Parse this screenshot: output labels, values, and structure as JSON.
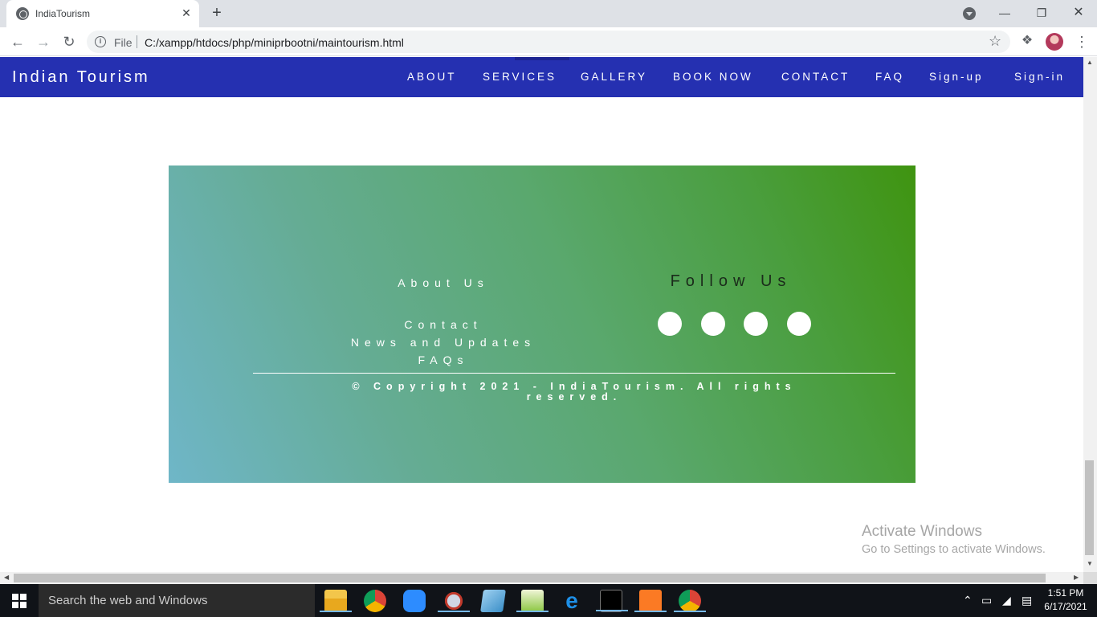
{
  "browser": {
    "tab_title": "IndiaTourism",
    "tab_close": "✕",
    "new_tab": "+",
    "scheme_label": "File",
    "url": "C:/xampp/htdocs/php/miniprbootni/maintourism.html"
  },
  "site": {
    "brand": "Indian Tourism",
    "nav": [
      "ABOUT",
      "SERVICES",
      "GALLERY",
      "BOOK NOW",
      "CONTACT",
      "FAQ",
      "Sign-up",
      "Sign-in"
    ]
  },
  "footer": {
    "about": "About Us",
    "links": [
      "Contact",
      "News and Updates",
      "FAQs"
    ],
    "follow_title": "Follow Us",
    "copyright": "© Copyright 2021 - IndiaTourism. All rights reserved."
  },
  "windows_watermark": {
    "title": "Activate Windows",
    "subtitle": "Go to Settings to activate Windows."
  },
  "taskbar": {
    "search_placeholder": "Search the web and Windows",
    "time": "1:51 PM",
    "date": "6/17/2021",
    "apps": [
      "file-explorer",
      "chrome",
      "zoom",
      "snipping-tool",
      "notes",
      "notepad-plus",
      "edge",
      "command-prompt",
      "xampp",
      "chrome-profile"
    ]
  },
  "colors": {
    "navbar": "#2530b1",
    "footer_gradient_start": "#6fb6c8",
    "footer_gradient_end": "#3f9410"
  }
}
